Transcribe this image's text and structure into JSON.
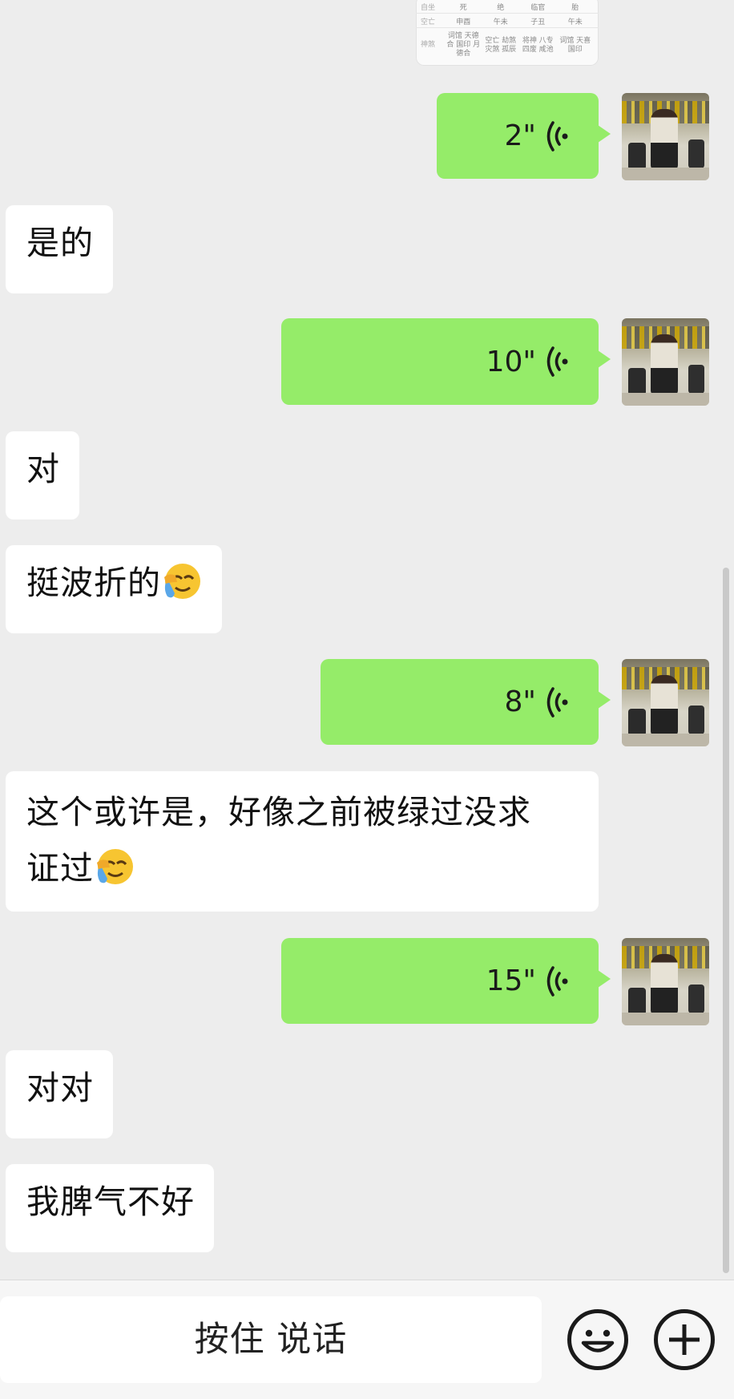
{
  "colors": {
    "background": "#ededed",
    "outgoing_bubble": "#95ec69",
    "incoming_bubble": "#ffffff",
    "bottom_bar": "#f6f6f6"
  },
  "top_image": {
    "rows": [
      {
        "label": "自坐",
        "cells": [
          "死",
          "绝",
          "临官",
          "胎"
        ]
      },
      {
        "label": "空亡",
        "cells": [
          "申酉",
          "午未",
          "子丑",
          "午未"
        ]
      },
      {
        "label": "神煞",
        "cells": [
          "词馆 天德合 国印 月德合",
          "空亡 劫煞 灾煞 孤辰",
          "将神 八专 四废 咸池",
          "词馆 天喜 国印"
        ]
      }
    ]
  },
  "messages": [
    {
      "type": "voice",
      "direction": "out",
      "duration": "2\""
    },
    {
      "type": "text",
      "direction": "in",
      "text": "是的"
    },
    {
      "type": "voice",
      "direction": "out",
      "duration": "10\""
    },
    {
      "type": "text",
      "direction": "in",
      "text": "对"
    },
    {
      "type": "text",
      "direction": "in",
      "text": "挺波折的",
      "emoji": "face-holding-back-tears-emoji"
    },
    {
      "type": "voice",
      "direction": "out",
      "duration": "8\""
    },
    {
      "type": "text",
      "direction": "in",
      "text_line1": "这个或许是，好像之前被绿过没求",
      "text_line2": "证过",
      "emoji": "face-holding-back-tears-emoji"
    },
    {
      "type": "voice",
      "direction": "out",
      "duration": "15\""
    },
    {
      "type": "text",
      "direction": "in",
      "text": "对对"
    },
    {
      "type": "text",
      "direction": "in",
      "text": "我脾气不好"
    }
  ],
  "input_bar": {
    "hold_to_talk_label": "按住 说话",
    "emoji_icon": "smiley-face-icon",
    "plus_icon": "plus-circle-icon"
  }
}
